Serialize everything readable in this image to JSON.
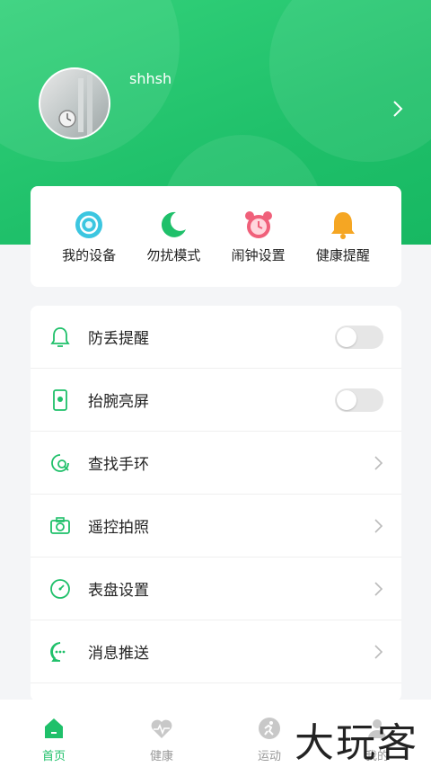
{
  "profile": {
    "username": "shhsh"
  },
  "quick_actions": [
    {
      "label": "我的设备",
      "icon": "watch-icon",
      "color": "#3cc6e0"
    },
    {
      "label": "勿扰模式",
      "icon": "moon-icon",
      "color": "#1fc06a"
    },
    {
      "label": "闹钟设置",
      "icon": "alarm-clock-icon",
      "color": "#f0607a"
    },
    {
      "label": "健康提醒",
      "icon": "bell-icon",
      "color": "#f5a623"
    }
  ],
  "settings": [
    {
      "label": "防丢提醒",
      "icon": "bell-outline-icon",
      "control": "toggle",
      "on": false
    },
    {
      "label": "抬腕亮屏",
      "icon": "wrist-screen-icon",
      "control": "toggle",
      "on": false
    },
    {
      "label": "查找手环",
      "icon": "find-band-icon",
      "control": "chevron"
    },
    {
      "label": "遥控拍照",
      "icon": "camera-icon",
      "control": "chevron"
    },
    {
      "label": "表盘设置",
      "icon": "watch-face-icon",
      "control": "chevron"
    },
    {
      "label": "消息推送",
      "icon": "message-icon",
      "control": "chevron"
    }
  ],
  "tabs": [
    {
      "label": "首页",
      "icon": "home-icon",
      "active": true
    },
    {
      "label": "健康",
      "icon": "heart-pulse-icon",
      "active": false
    },
    {
      "label": "运动",
      "icon": "running-icon",
      "active": false
    },
    {
      "label": "我的",
      "icon": "user-icon",
      "active": false
    }
  ],
  "watermark": "大玩客",
  "colors": {
    "accent": "#1fc06a",
    "toggle_off": "#e6e6e6",
    "inactive_tab": "#c8c8c8"
  }
}
